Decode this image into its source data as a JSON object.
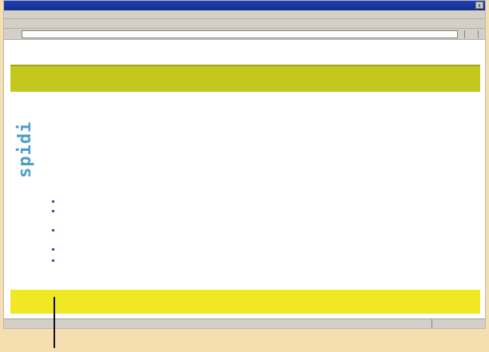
{
  "window": {
    "title": "",
    "close_glyph": "x"
  },
  "menubar": {
    "items": [
      "",
      "",
      "",
      "",
      "",
      ""
    ]
  },
  "toolbar": {
    "items": [
      "",
      "",
      "",
      "",
      ""
    ]
  },
  "addressbar": {
    "label": "",
    "value": "",
    "go_label": "",
    "links_label": ""
  },
  "banner": {
    "top_text": "",
    "bottom_text": ""
  },
  "logo": {
    "text": "spidi"
  },
  "search": {
    "heading": "",
    "lines": [
      "",
      "",
      ""
    ]
  },
  "results": {
    "heading": "",
    "header_col1": "",
    "header_col2": "",
    "rows": [
      {
        "c1": "",
        "c2": ""
      },
      {
        "c1": "",
        "c2": ""
      },
      {
        "c1": "",
        "c2": ""
      },
      {
        "c1": "",
        "c2": ""
      },
      {
        "c1": "",
        "c2": ""
      },
      {
        "c1": "",
        "c2": ""
      },
      {
        "c1": "",
        "c2": ""
      }
    ]
  },
  "status": {
    "left": "",
    "zone": ""
  },
  "colors": {
    "banner": "#c4c81d",
    "footer": "#f0e823",
    "logo": "#4f9fc7",
    "heading": "#4f7fbf"
  }
}
